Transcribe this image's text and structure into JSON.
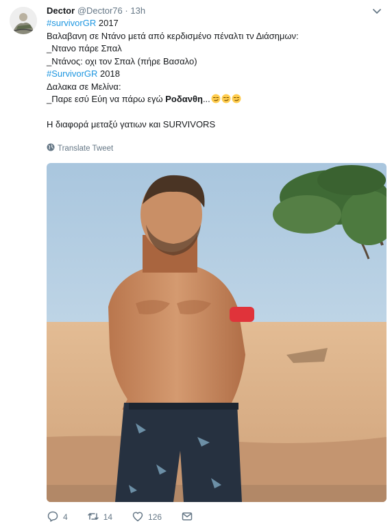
{
  "tweet": {
    "author_name": "Dector",
    "handle": "@Dector76",
    "separator": "·",
    "time": "13h",
    "lines": {
      "l1_tag": "#survivorGR",
      "l1_rest": " 2017",
      "l2": "Βαλαβανη σε Ντάνο μετά από κερδισμένο πέναλτι τν Διάσημων:",
      "l3": "_Ντανο πάρε Σπαλ",
      "l4": "_Ντάνος: οχι τον Σπαλ (πήρε Βασαλο)",
      "l5_tag": "#SurvivorGR",
      "l5_rest": " 2018",
      "l6": "Δαλακα σε Μελίνα:",
      "l7_pre": "_Παρε εσύ Εύη να πάρω εγώ ",
      "l7_bold": "Ροδανθη",
      "l7_post": "...",
      "l8": "Η διαφορά μεταξύ γατιων και SURVIVORS"
    },
    "translate_label": "Translate Tweet"
  },
  "actions": {
    "replies": "4",
    "retweets": "14",
    "likes": "126"
  },
  "colors": {
    "link": "#1b95e0",
    "muted": "#657786",
    "text": "#14171a"
  },
  "icons": [
    "chevron-down-icon",
    "globe-icon",
    "reply-icon",
    "retweet-icon",
    "like-icon",
    "message-icon",
    "smirk-emoji-icon"
  ]
}
